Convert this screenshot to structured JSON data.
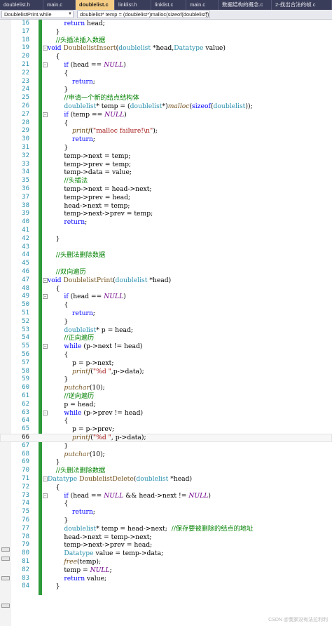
{
  "tabs": [
    {
      "label": "doublelist.h",
      "width": 62
    },
    {
      "label": "main.c",
      "width": 46
    },
    {
      "label": "doublelist.c",
      "width": 56,
      "active": true
    },
    {
      "label": "linklist.h",
      "width": 52
    },
    {
      "label": "linklist.c",
      "width": 50
    },
    {
      "label": "main.c",
      "width": 46
    },
    {
      "label": "数据结构的概念.c",
      "width": 76
    },
    {
      "label": "2-找出合法的帧.c",
      "width": 86
    }
  ],
  "navbar": {
    "scope_dropdown": "DoublelistPrint.while",
    "member_dropdown": "doublelist* temp = (doublelist*)malloc(sizeof(doublelist))"
  },
  "editor": {
    "current_line": "66",
    "lines": [
      {
        "n": "16",
        "t": "        return head;"
      },
      {
        "n": "17",
        "t": "    }"
      },
      {
        "n": "18",
        "t": "    //头插法插入数据"
      },
      {
        "n": "19",
        "t": "void DoublelistInsert(doublelist *head,Datatype value)"
      },
      {
        "n": "20",
        "t": "    {"
      },
      {
        "n": "21",
        "t": "        if (head == NULL)"
      },
      {
        "n": "22",
        "t": "        {"
      },
      {
        "n": "23",
        "t": "            return;"
      },
      {
        "n": "24",
        "t": "        }"
      },
      {
        "n": "25",
        "t": "        //申请一个新的结点结构体"
      },
      {
        "n": "26",
        "t": "        doublelist* temp = (doublelist*)malloc(sizeof(doublelist));"
      },
      {
        "n": "27",
        "t": "        if (temp == NULL)"
      },
      {
        "n": "28",
        "t": "        {"
      },
      {
        "n": "29",
        "t": "            printf(\"malloc failure!\\n\");"
      },
      {
        "n": "30",
        "t": "            return;"
      },
      {
        "n": "31",
        "t": "        }"
      },
      {
        "n": "32",
        "t": "        temp->next = temp;"
      },
      {
        "n": "33",
        "t": "        temp->prev = temp;"
      },
      {
        "n": "34",
        "t": "        temp->data = value;"
      },
      {
        "n": "35",
        "t": "        //头插法"
      },
      {
        "n": "36",
        "t": "        temp->next = head->next;"
      },
      {
        "n": "37",
        "t": "        temp->prev = head;"
      },
      {
        "n": "38",
        "t": "        head->next = temp;"
      },
      {
        "n": "39",
        "t": "        temp->next->prev = temp;"
      },
      {
        "n": "40",
        "t": "        return;"
      },
      {
        "n": "41",
        "t": ""
      },
      {
        "n": "42",
        "t": "    }"
      },
      {
        "n": "43",
        "t": ""
      },
      {
        "n": "44",
        "t": "    //头删法删除数据"
      },
      {
        "n": "45",
        "t": ""
      },
      {
        "n": "46",
        "t": "    //双向遍历"
      },
      {
        "n": "47",
        "t": "void DoublelistPrint(doublelist *head)"
      },
      {
        "n": "48",
        "t": "    {"
      },
      {
        "n": "49",
        "t": "        if (head == NULL)"
      },
      {
        "n": "50",
        "t": "        {"
      },
      {
        "n": "51",
        "t": "            return;"
      },
      {
        "n": "52",
        "t": "        }"
      },
      {
        "n": "53",
        "t": "        doublelist* p = head;"
      },
      {
        "n": "54",
        "t": "        //正向遍历"
      },
      {
        "n": "55",
        "t": "        while (p->next != head)"
      },
      {
        "n": "56",
        "t": "        {"
      },
      {
        "n": "57",
        "t": "            p = p->next;"
      },
      {
        "n": "58",
        "t": "            printf(\"%d \",p->data);"
      },
      {
        "n": "59",
        "t": "        }"
      },
      {
        "n": "60",
        "t": "        putchar(10);"
      },
      {
        "n": "61",
        "t": "        //逆向遍历"
      },
      {
        "n": "62",
        "t": "        p = head;"
      },
      {
        "n": "63",
        "t": "        while (p->prev != head)"
      },
      {
        "n": "64",
        "t": "        {"
      },
      {
        "n": "65",
        "t": "            p = p->prev;"
      },
      {
        "n": "66",
        "t": "            printf(\"%d \", p->data);"
      },
      {
        "n": "67",
        "t": "        }"
      },
      {
        "n": "68",
        "t": "        putchar(10);"
      },
      {
        "n": "69",
        "t": "    }"
      },
      {
        "n": "70",
        "t": "    //头删法删除数据"
      },
      {
        "n": "71",
        "t": "Datatype DoublelistDelete(doublelist *head)"
      },
      {
        "n": "72",
        "t": "    {"
      },
      {
        "n": "73",
        "t": "        if (head == NULL && head->next != NULL)"
      },
      {
        "n": "74",
        "t": "        {"
      },
      {
        "n": "75",
        "t": "            return;"
      },
      {
        "n": "76",
        "t": "        }"
      },
      {
        "n": "77",
        "t": "        doublelist* temp = head->next;  //保存要被删除的结点的地址"
      },
      {
        "n": "78",
        "t": "        head->next = temp->next;"
      },
      {
        "n": "79",
        "t": "        temp->next->prev = head;"
      },
      {
        "n": "80",
        "t": "        Datatype value = temp->data;"
      },
      {
        "n": "81",
        "t": "        free(temp);"
      },
      {
        "n": "82",
        "t": "        temp = NULL;"
      },
      {
        "n": "83",
        "t": "        return value;"
      },
      {
        "n": "84",
        "t": "    }"
      }
    ]
  },
  "watermark": "CSDN @我家没有法拉利利",
  "colors": {
    "keyword": "#0000ff",
    "type": "#2b91af",
    "comment": "#008000",
    "string": "#a31515",
    "macro": "#6f008a",
    "function": "#74531f",
    "change_bar": "#2e9a3a",
    "active_tab": "#f5cc84",
    "tab_bar": "#3a3d59"
  }
}
